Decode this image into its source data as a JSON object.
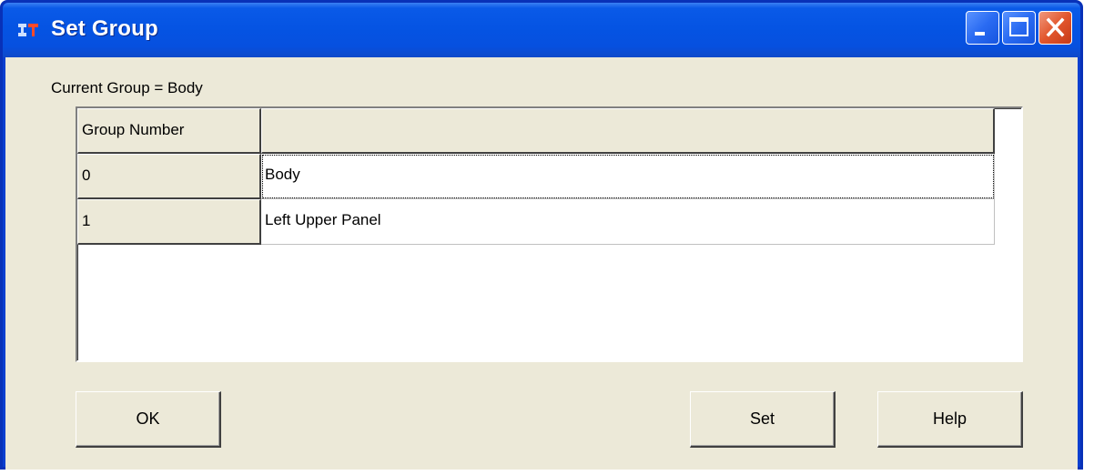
{
  "window": {
    "title": "Set Group",
    "controls": [
      "minimize-icon",
      "maximize-icon",
      "close-icon"
    ]
  },
  "current_group_label": "Current Group = Body",
  "grid": {
    "header": [
      "Group Number",
      ""
    ],
    "rows": [
      {
        "number": "0",
        "name": "Body",
        "focused": true
      },
      {
        "number": "1",
        "name": "Left Upper Panel",
        "focused": false
      }
    ]
  },
  "buttons": {
    "ok": "OK",
    "set": "Set",
    "help": "Help"
  },
  "colors": {
    "titlebar": "#0554e3",
    "dialog_face": "#ece9d8",
    "close_button": "#e2562d"
  }
}
